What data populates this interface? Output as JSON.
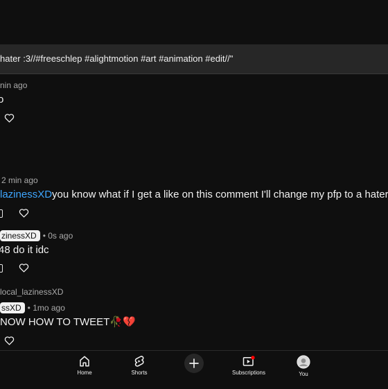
{
  "video": {
    "title": "hater :3//#freeschlep #alightmotion #art #animation #edit//\""
  },
  "comments": [
    {
      "time": "nin ago",
      "text": "o"
    },
    {
      "author": "",
      "time": "2 min ago",
      "mention": "lazinessXD",
      "text": "you know what if I get a like on this comment I'll change my pfp to a hater"
    },
    {
      "chip": "zinessXD",
      "time": "• 0s ago",
      "text": "48 do it idc"
    },
    {
      "replying_to": "local_lazinessXD",
      "chip": "ssXD",
      "time": "• 1mo ago",
      "text": "NOW HOW TO TWEET🥀💔"
    }
  ],
  "nav": {
    "home": "Home",
    "shorts": "Shorts",
    "create": "+",
    "subscriptions": "Subscriptions",
    "you": "You"
  },
  "colors": {
    "background": "#0f0f0f",
    "banner": "#272727",
    "mention": "#3ea6ff",
    "notification_dot": "#ff0000"
  },
  "icons": [
    "heart-icon",
    "home-icon",
    "shorts-icon",
    "plus-icon",
    "subscriptions-icon",
    "avatar"
  ]
}
